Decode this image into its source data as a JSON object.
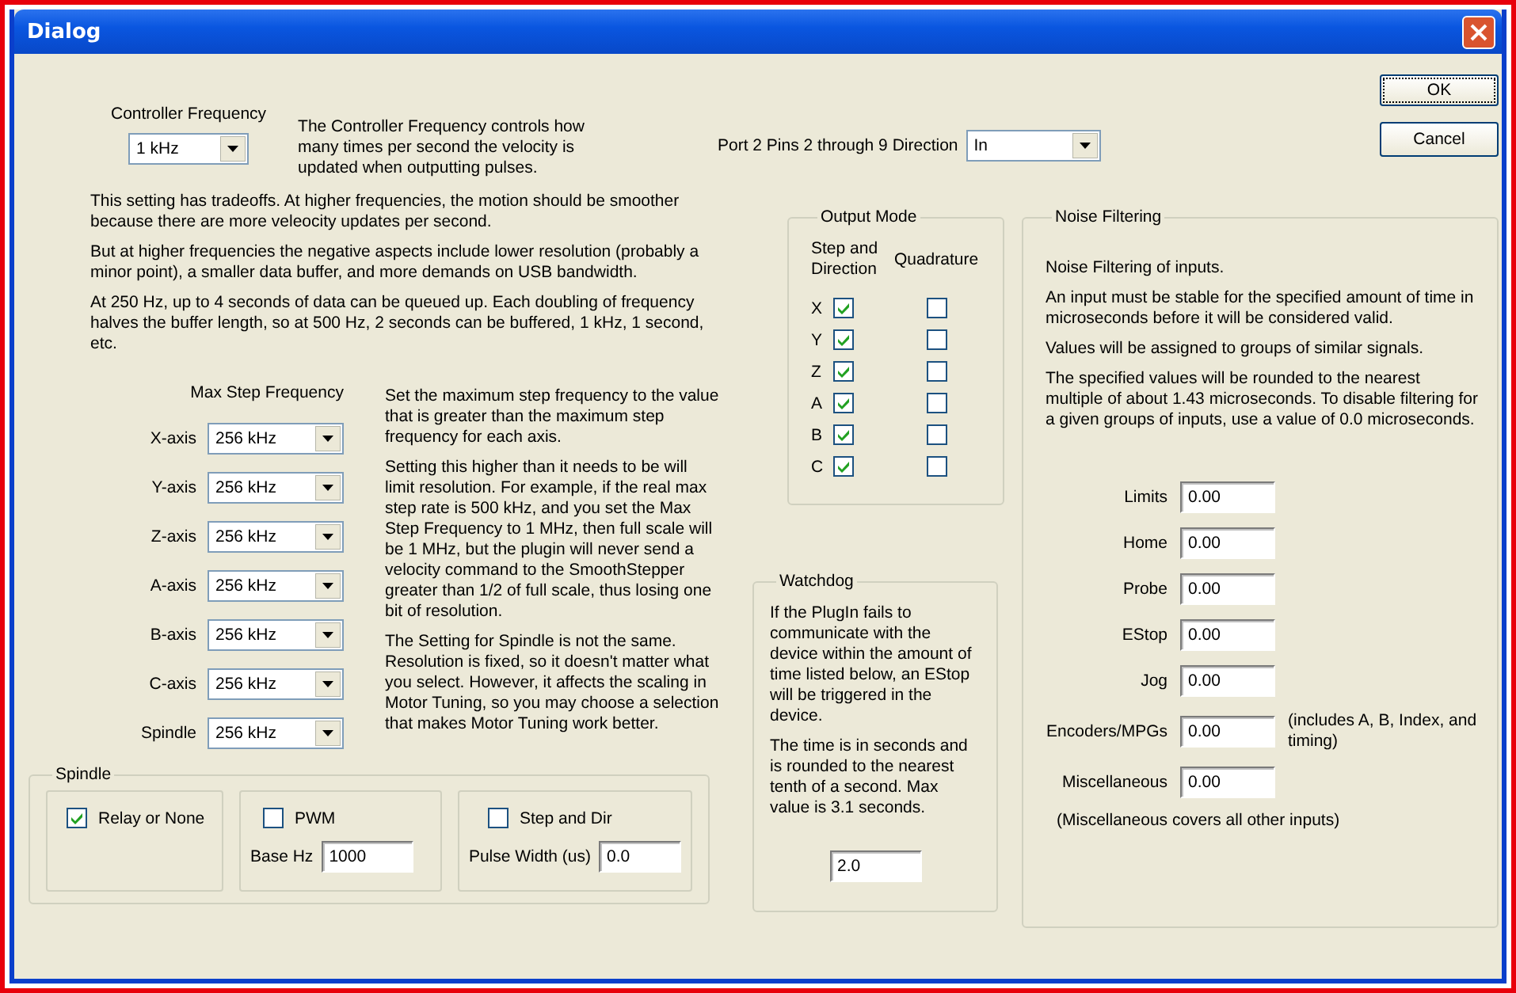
{
  "window": {
    "title": "Dialog"
  },
  "controller_frequency": {
    "label": "Controller Frequency",
    "value": "1 kHz",
    "description": "The Controller Frequency controls how many times per second the velocity is updated when outputting pulses."
  },
  "notes": [
    "This setting has tradeoffs.  At higher frequencies, the motion should be smoother because there are more veleocity updates per second.",
    "But at higher frequencies the negative aspects include lower resolution (probably a minor point), a smaller data buffer, and more demands on USB bandwidth.",
    "At 250 Hz, up to 4 seconds of data can be queued up.  Each doubling of frequency halves the buffer length, so at 500 Hz, 2 seconds can be buffered, 1 kHz, 1 second, etc."
  ],
  "max_step_frequency": {
    "title": "Max Step Frequency",
    "axes": [
      {
        "label": "X-axis",
        "value": "256 kHz"
      },
      {
        "label": "Y-axis",
        "value": "256 kHz"
      },
      {
        "label": "Z-axis",
        "value": "256 kHz"
      },
      {
        "label": "A-axis",
        "value": "256 kHz"
      },
      {
        "label": "B-axis",
        "value": "256 kHz"
      },
      {
        "label": "C-axis",
        "value": "256 kHz"
      },
      {
        "label": "Spindle",
        "value": "256 kHz"
      }
    ],
    "notes": [
      "Set the maximum step frequency to the value that is greater than the maximum step frequency for each axis.",
      "Setting this higher than it needs to be will limit resolution.  For example, if the real max step rate is 500 kHz, and you set the Max Step Frequency to 1 MHz, then full scale will be 1 MHz, but the plugin will never send a velocity command to the SmoothStepper greater than 1/2 of full scale, thus losing one bit of resolution.",
      "The Setting for Spindle is not the same. Resolution is fixed, so it doesn't matter what you select.  However, it affects the scaling in Motor Tuning, so you may choose a selection that makes Motor Tuning work better."
    ]
  },
  "spindle": {
    "title": "Spindle",
    "options": [
      {
        "label": "Relay or None",
        "checked": true
      },
      {
        "label": "PWM",
        "checked": false,
        "field_label": "Base Hz",
        "value": "1000"
      },
      {
        "label": "Step and Dir",
        "checked": false,
        "field_label": "Pulse Width (us)",
        "value": "0.0"
      }
    ]
  },
  "port_direction": {
    "label": "Port 2 Pins 2 through 9 Direction",
    "value": "In"
  },
  "buttons": [
    {
      "label": "OK",
      "focused": true
    },
    {
      "label": "Cancel",
      "focused": false
    }
  ],
  "output_mode": {
    "title": "Output Mode",
    "columns": [
      "Step and Direction",
      "Quadrature"
    ],
    "axes": [
      {
        "label": "X",
        "step_and_direction": true,
        "quadrature": false
      },
      {
        "label": "Y",
        "step_and_direction": true,
        "quadrature": false
      },
      {
        "label": "Z",
        "step_and_direction": true,
        "quadrature": false
      },
      {
        "label": "A",
        "step_and_direction": true,
        "quadrature": false
      },
      {
        "label": "B",
        "step_and_direction": true,
        "quadrature": false
      },
      {
        "label": "C",
        "step_and_direction": true,
        "quadrature": false
      }
    ]
  },
  "watchdog": {
    "title": "Watchdog",
    "notes": [
      "If the PlugIn fails to communicate with the device within the amount of time listed below, an EStop will be triggered in the device.",
      "The time is in seconds and is rounded to the nearest tenth of a second.  Max value is 3.1 seconds."
    ],
    "value": "2.0"
  },
  "noise_filtering": {
    "title": "Noise Filtering",
    "notes": [
      "Noise Filtering of inputs.",
      "An input must be stable for the specified amount of time in microseconds before it will be considered valid.",
      "Values will be assigned to groups of similar signals.",
      "The specified values will be rounded to the nearest multiple of about 1.43 microseconds.  To disable filtering for a given groups of inputs, use a value of 0.0 microseconds."
    ],
    "inputs": [
      {
        "label": "Limits",
        "value": "0.00"
      },
      {
        "label": "Home",
        "value": "0.00"
      },
      {
        "label": "Probe",
        "value": "0.00"
      },
      {
        "label": "EStop",
        "value": "0.00"
      },
      {
        "label": "Jog",
        "value": "0.00"
      },
      {
        "label": "Encoders/MPGs",
        "value": "0.00",
        "note": "(includes A, B, Index, and timing)"
      },
      {
        "label": "Miscellaneous",
        "value": "0.00"
      }
    ],
    "footnote": "(Miscellaneous covers all other inputs)"
  }
}
